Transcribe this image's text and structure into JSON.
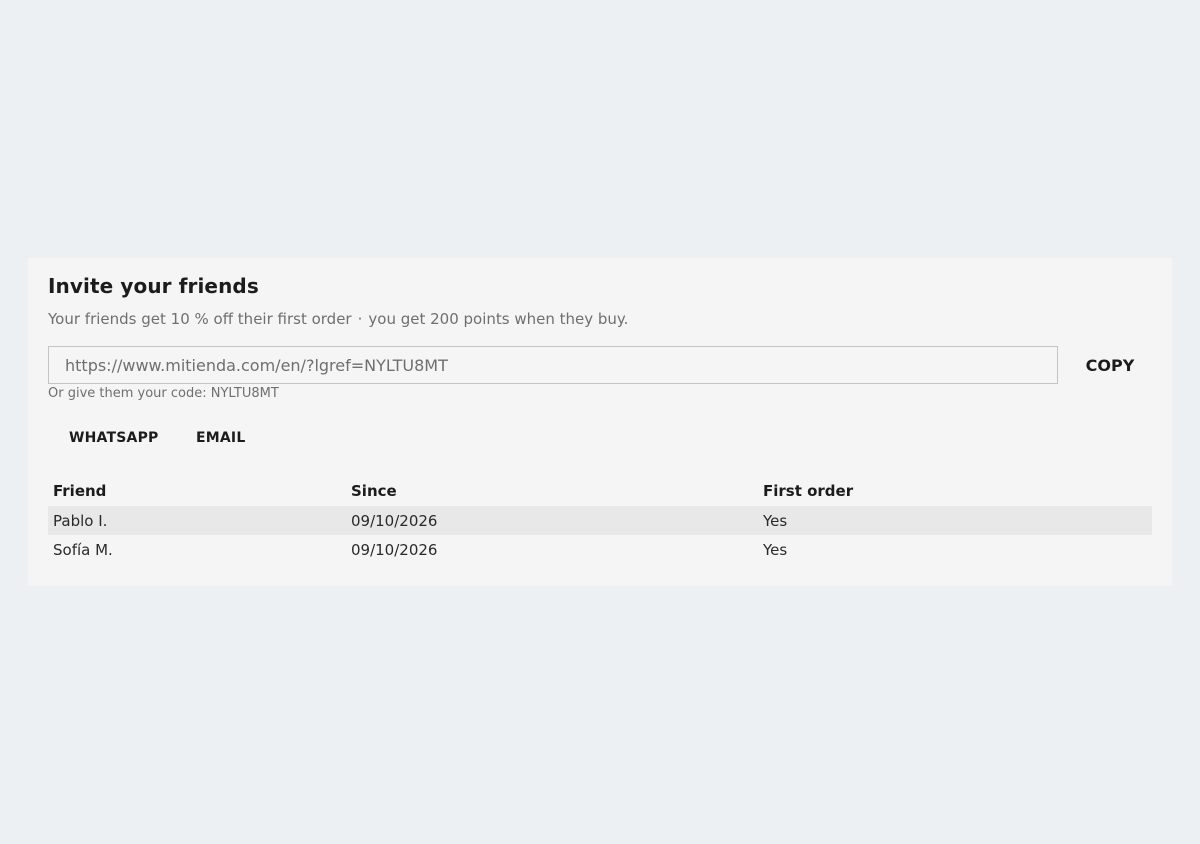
{
  "invite": {
    "title": "Invite your friends",
    "subtitle_part1": "Your friends get 10 % off their first order",
    "subtitle_separator": "·",
    "subtitle_part2": "you get 200 points when they buy.",
    "referral_link": "https://www.mitienda.com/en/?lgref=NYLTU8MT",
    "copy_label": "COPY",
    "code_line": "Or give them your code: NYLTU8MT",
    "share_buttons": {
      "whatsapp": "WHATSAPP",
      "email": "EMAIL"
    }
  },
  "friends_table": {
    "columns": [
      "Friend",
      "Since",
      "First order"
    ],
    "rows": [
      {
        "friend": "Pablo I.",
        "since": "09/10/2026",
        "first_order": "Yes"
      },
      {
        "friend": "Sofía M.",
        "since": "09/10/2026",
        "first_order": "Yes"
      }
    ]
  }
}
